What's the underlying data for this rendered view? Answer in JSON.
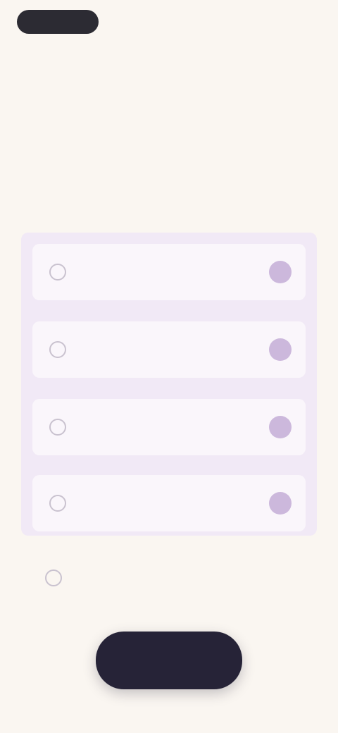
{
  "header": {
    "back_label": "",
    "right_label": ""
  },
  "kicker": "",
  "title": "",
  "options": [
    {
      "label": "",
      "selected": false
    },
    {
      "label": "",
      "selected": false
    },
    {
      "label": "",
      "selected": false
    },
    {
      "label": "",
      "selected": false
    }
  ],
  "none_option": {
    "label": "",
    "selected": false
  },
  "primary_button": {
    "label": ""
  },
  "colors": {
    "background": "#faf6f1",
    "panel": "#f1e9f6",
    "option_bg": "#faf6fb",
    "badge": "#ccb8dc",
    "button": "#262337"
  },
  "icons": {
    "option_badge": "info-icon"
  }
}
